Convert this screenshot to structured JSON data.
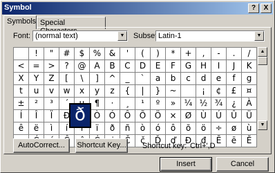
{
  "window": {
    "title": "Symbol",
    "help_label": "?",
    "close_label": "X"
  },
  "tabs": [
    {
      "label": "Symbols",
      "active": true
    },
    {
      "label": "Special Characters",
      "active": false
    }
  ],
  "font": {
    "label": "Font:",
    "value": "(normal text)"
  },
  "subset": {
    "label": "Subset:",
    "value": "Latin-1"
  },
  "symbols": [
    "",
    "!",
    "\"",
    "#",
    "$",
    "%",
    "&",
    "'",
    "(",
    ")",
    "*",
    "+",
    ",",
    "-",
    ".",
    "/",
    "<",
    "=",
    ">",
    "?",
    "@",
    "A",
    "B",
    "C",
    "D",
    "E",
    "F",
    "G",
    "H",
    "I",
    "J",
    "K",
    "X",
    "Y",
    "Z",
    "[",
    "\\",
    "]",
    "^",
    "_",
    "`",
    "a",
    "b",
    "c",
    "d",
    "e",
    "f",
    "g",
    "t",
    "u",
    "v",
    "w",
    "x",
    "y",
    "z",
    "{",
    "|",
    "}",
    "~",
    "",
    "¡",
    "¢",
    "£",
    "¤",
    "±",
    "²",
    "³",
    "´",
    "µ",
    "¶",
    "·",
    "¸",
    "¹",
    "º",
    "»",
    "¼",
    "½",
    "¾",
    "¿",
    "À",
    "Í",
    "Î",
    "Ï",
    "Ð",
    "Ñ",
    "Ò",
    "Ó",
    "Ô",
    "Õ",
    "Ö",
    "×",
    "Ø",
    "Ù",
    "Ú",
    "Û",
    "Ü",
    "ê",
    "ë",
    "ì",
    "í",
    "î",
    "ï",
    "ð",
    "ñ",
    "ò",
    "ó",
    "ô",
    "õ",
    "ö",
    "÷",
    "ø",
    "ù",
    "ą",
    "Ć",
    "ć",
    "Ĉ",
    "ĉ",
    "Ċ",
    "ċ",
    "Č",
    "č",
    "Ď",
    "ď",
    "Đ",
    "đ",
    "Ē",
    "ē",
    "Ĕ"
  ],
  "magnified_symbol": "ð",
  "buttons": {
    "autocorrect": "AutoCorrect...",
    "shortcut_key": "Shortcut Key...",
    "insert": "Insert",
    "cancel": "Cancel"
  },
  "shortcut": {
    "label": "Shortcut key:",
    "value": "Ctrl+',D"
  },
  "colors": {
    "title_start": "#0a246a",
    "title_end": "#a6caf0",
    "face": "#d4d0c8"
  }
}
